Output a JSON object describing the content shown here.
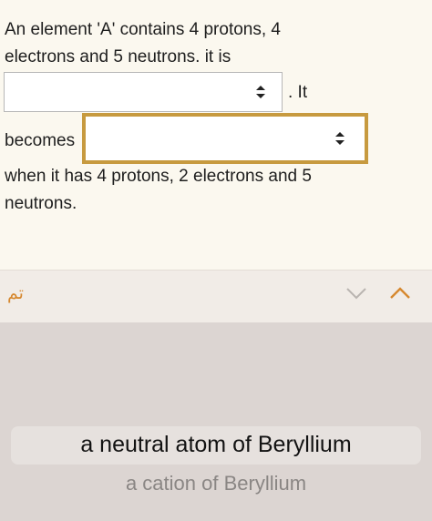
{
  "question": {
    "line1": "An element 'A' contains 4 protons, 4",
    "line2": "electrons and 5 neutrons. it is",
    "after_first_select": ". It",
    "becomes_label": "becomes",
    "line4": "when it has 4 protons, 2 electrons and 5",
    "line5": "neutrons."
  },
  "toolbar": {
    "done_label": "تم",
    "prev_icon": "chevron-down-icon",
    "next_icon": "chevron-up-icon"
  },
  "picker": {
    "options": [
      "a neutral atom of Beryllium",
      "a cation of Beryllium"
    ],
    "selected_index": 0
  },
  "colors": {
    "accent": "#d6882f",
    "active_border": "#c79a3f",
    "question_bg": "#fbf8ef",
    "picker_bg": "#dcd5d2"
  }
}
